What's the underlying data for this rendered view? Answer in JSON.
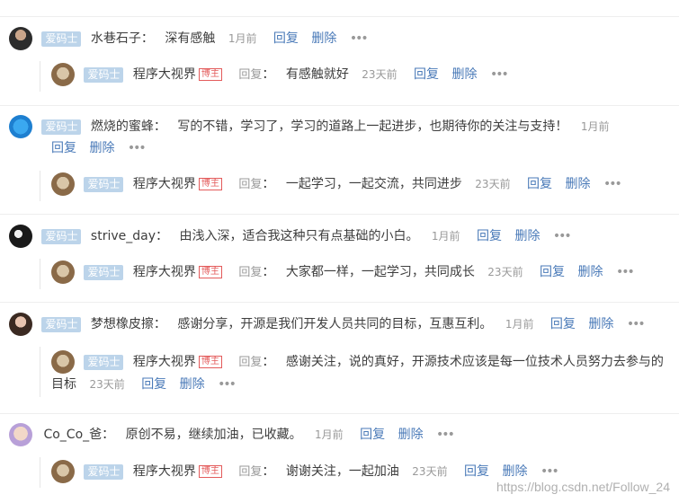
{
  "badge_label": "爱码士",
  "blog_badge": "博主",
  "reply_word": "回复",
  "colon": "：",
  "reply_action": "回复",
  "delete_action": "删除",
  "more_icon": "•••",
  "comments": [
    {
      "name": "水巷石子",
      "text": "深有感触",
      "time": "1月前",
      "reply": {
        "name": "程序大视界",
        "text": "有感触就好",
        "time": "23天前"
      }
    },
    {
      "name": "燃烧的蜜蜂",
      "text": "写的不错，学习了，学习的道路上一起进步，也期待你的关注与支持！",
      "time": "1月前",
      "reply": {
        "name": "程序大视界",
        "text": "一起学习，一起交流，共同进步",
        "time": "23天前"
      }
    },
    {
      "name": "strive_day",
      "text": "由浅入深，适合我这种只有点基础的小白。",
      "time": "1月前",
      "reply": {
        "name": "程序大视界",
        "text": "大家都一样，一起学习，共同成长",
        "time": "23天前"
      }
    },
    {
      "name": "梦想橡皮擦",
      "text": "感谢分享，开源是我们开发人员共同的目标，互惠互利。",
      "time": "1月前",
      "reply": {
        "name": "程序大视界",
        "text": "感谢关注，说的真好，开源技术应该是每一位技术人员努力去参与的目标",
        "time": "23天前"
      }
    },
    {
      "name": "Co_Co_爸",
      "text": "原创不易，继续加油，已收藏。",
      "time": "1月前",
      "reply": {
        "name": "程序大视界",
        "text": "谢谢关注，一起加油",
        "time": "23天前"
      }
    }
  ],
  "watermark": "https://blog.csdn.net/Follow_24"
}
